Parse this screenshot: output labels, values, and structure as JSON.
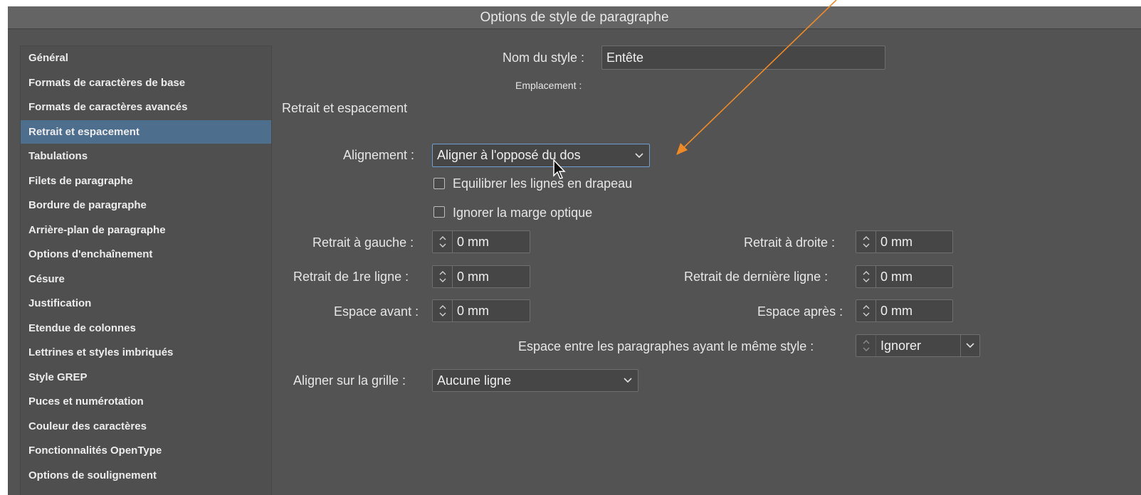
{
  "dialog": {
    "title": "Options de style de paragraphe"
  },
  "sidebar": {
    "items": [
      {
        "label": "Général",
        "selected": false
      },
      {
        "label": "Formats de caractères de base",
        "selected": false
      },
      {
        "label": "Formats de caractères avancés",
        "selected": false
      },
      {
        "label": "Retrait et espacement",
        "selected": true
      },
      {
        "label": "Tabulations",
        "selected": false
      },
      {
        "label": "Filets de paragraphe",
        "selected": false
      },
      {
        "label": "Bordure de paragraphe",
        "selected": false
      },
      {
        "label": "Arrière-plan de paragraphe",
        "selected": false
      },
      {
        "label": "Options d'enchaînement",
        "selected": false
      },
      {
        "label": "Césure",
        "selected": false
      },
      {
        "label": "Justification",
        "selected": false
      },
      {
        "label": "Etendue de colonnes",
        "selected": false
      },
      {
        "label": "Lettrines et styles imbriqués",
        "selected": false
      },
      {
        "label": "Style GREP",
        "selected": false
      },
      {
        "label": "Puces et numérotation",
        "selected": false
      },
      {
        "label": "Couleur des caractères",
        "selected": false
      },
      {
        "label": "Fonctionnalités OpenType",
        "selected": false
      },
      {
        "label": "Options de soulignement",
        "selected": false
      }
    ]
  },
  "main": {
    "style_name_label": "Nom du style :",
    "style_name_value": "Entête",
    "location_label": "Emplacement :",
    "section_title": "Retrait et espacement",
    "alignment_label": "Alignement :",
    "alignment_value": "Aligner à l'opposé du dos",
    "balance_label": "Equilibrer les lignes en drapeau",
    "ignore_margin_label": "Ignorer la marge optique",
    "left_indent_label": "Retrait à gauche :",
    "left_indent_value": "0 mm",
    "right_indent_label": "Retrait à droite :",
    "right_indent_value": "0 mm",
    "first_line_label": "Retrait de 1re ligne :",
    "first_line_value": "0 mm",
    "last_line_label": "Retrait de dernière ligne :",
    "last_line_value": "0 mm",
    "space_before_label": "Espace avant :",
    "space_before_value": "0 mm",
    "space_after_label": "Espace après :",
    "space_after_value": "0 mm",
    "same_style_label": "Espace entre les paragraphes ayant le même style :",
    "same_style_value": "Ignorer",
    "grid_label": "Aligner sur la grille :",
    "grid_value": "Aucune ligne"
  },
  "colors": {
    "dialog_bg": "#535353",
    "titlebar_bg": "#646464",
    "selection": "#4e6e8e",
    "focus_ring": "#6f9fd4",
    "annotation_arrow": "#f08a24"
  }
}
